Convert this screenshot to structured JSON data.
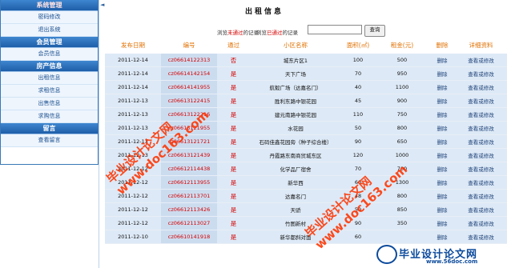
{
  "sidebar": {
    "sections": [
      {
        "title": "系统管理",
        "red": true,
        "items": [
          "密码修改",
          "退出系统"
        ]
      },
      {
        "title": "会员管理",
        "red": false,
        "items": [
          "会员信息"
        ]
      },
      {
        "title": "房产信息",
        "red": false,
        "items": [
          "出租信息",
          "求租信息",
          "出售信息",
          "求购信息"
        ]
      },
      {
        "title": "留言",
        "red": false,
        "items": [
          "查看留言"
        ]
      }
    ]
  },
  "page": {
    "title": "出租信息"
  },
  "filters": {
    "unapproved": [
      "浏览",
      "未通过",
      "的记录"
    ],
    "approved": [
      "浏览",
      "已通过",
      "的记录"
    ],
    "search_button": "查询",
    "search_value": ""
  },
  "table": {
    "headers": [
      "发布日期",
      "编号",
      "通过",
      "小区名称",
      "面积(㎡)",
      "租金(元)",
      "删除",
      "详细资料"
    ],
    "rows": [
      [
        "2011-12-14",
        "cz06614122313",
        "否",
        "城东片区1",
        "100",
        "500",
        "删除",
        "查看或修改"
      ],
      [
        "2011-12-14",
        "cz06614142154",
        "是",
        "天下广场",
        "70",
        "950",
        "删除",
        "查看或修改"
      ],
      [
        "2011-12-14",
        "cz06614141955",
        "是",
        "航毅广场（达嘉名门）",
        "40",
        "1100",
        "删除",
        "查看或修改"
      ],
      [
        "2011-12-13",
        "cz06613122415",
        "是",
        "胜利东路中银花园",
        "45",
        "900",
        "删除",
        "查看或修改"
      ],
      [
        "2011-12-13",
        "cz06613122216",
        "是",
        "建元南路中银花园",
        "110",
        "750",
        "删除",
        "查看或修改"
      ],
      [
        "2011-12-13",
        "cz06613121955",
        "是",
        "水花园",
        "50",
        "800",
        "删除",
        "查看或修改"
      ],
      [
        "2011-12-13",
        "cz06613121721",
        "是",
        "石码佳鑫花园旁（种子综合楼）",
        "90",
        "650",
        "删除",
        "查看或修改"
      ],
      [
        "2011-12-13",
        "cz06613121439",
        "是",
        "丹霞路东南商贸城东区",
        "120",
        "1000",
        "删除",
        "查看或修改"
      ],
      [
        "2011-12-12",
        "cz06612114438",
        "是",
        "化学品厂宿舍",
        "70",
        "700",
        "删除",
        "查看或修改"
      ],
      [
        "2011-12-12",
        "cz06612113955",
        "是",
        "新华西",
        "60",
        "1300",
        "删除",
        "查看或修改"
      ],
      [
        "2011-12-12",
        "cz06612113701",
        "是",
        "达嘉名门",
        "48",
        "800",
        "删除",
        "查看或修改"
      ],
      [
        "2011-12-12",
        "cz06612113426",
        "是",
        "天骄",
        "50",
        "850",
        "删除",
        "查看或修改"
      ],
      [
        "2011-12-12",
        "cz06612113027",
        "是",
        "竹图新村",
        "90",
        "350",
        "删除",
        "查看或修改"
      ],
      [
        "2011-12-10",
        "cz06610141918",
        "是",
        "新华都斜对面",
        "60",
        "",
        "删除",
        "查看或修改"
      ]
    ]
  },
  "watermarks": [
    "毕业设计论文网",
    "www.doc163.com",
    "毕业设计论文网",
    "www.doc163.com"
  ],
  "banner": {
    "text": "毕业设计论文网",
    "url": "www.56doc.com"
  }
}
